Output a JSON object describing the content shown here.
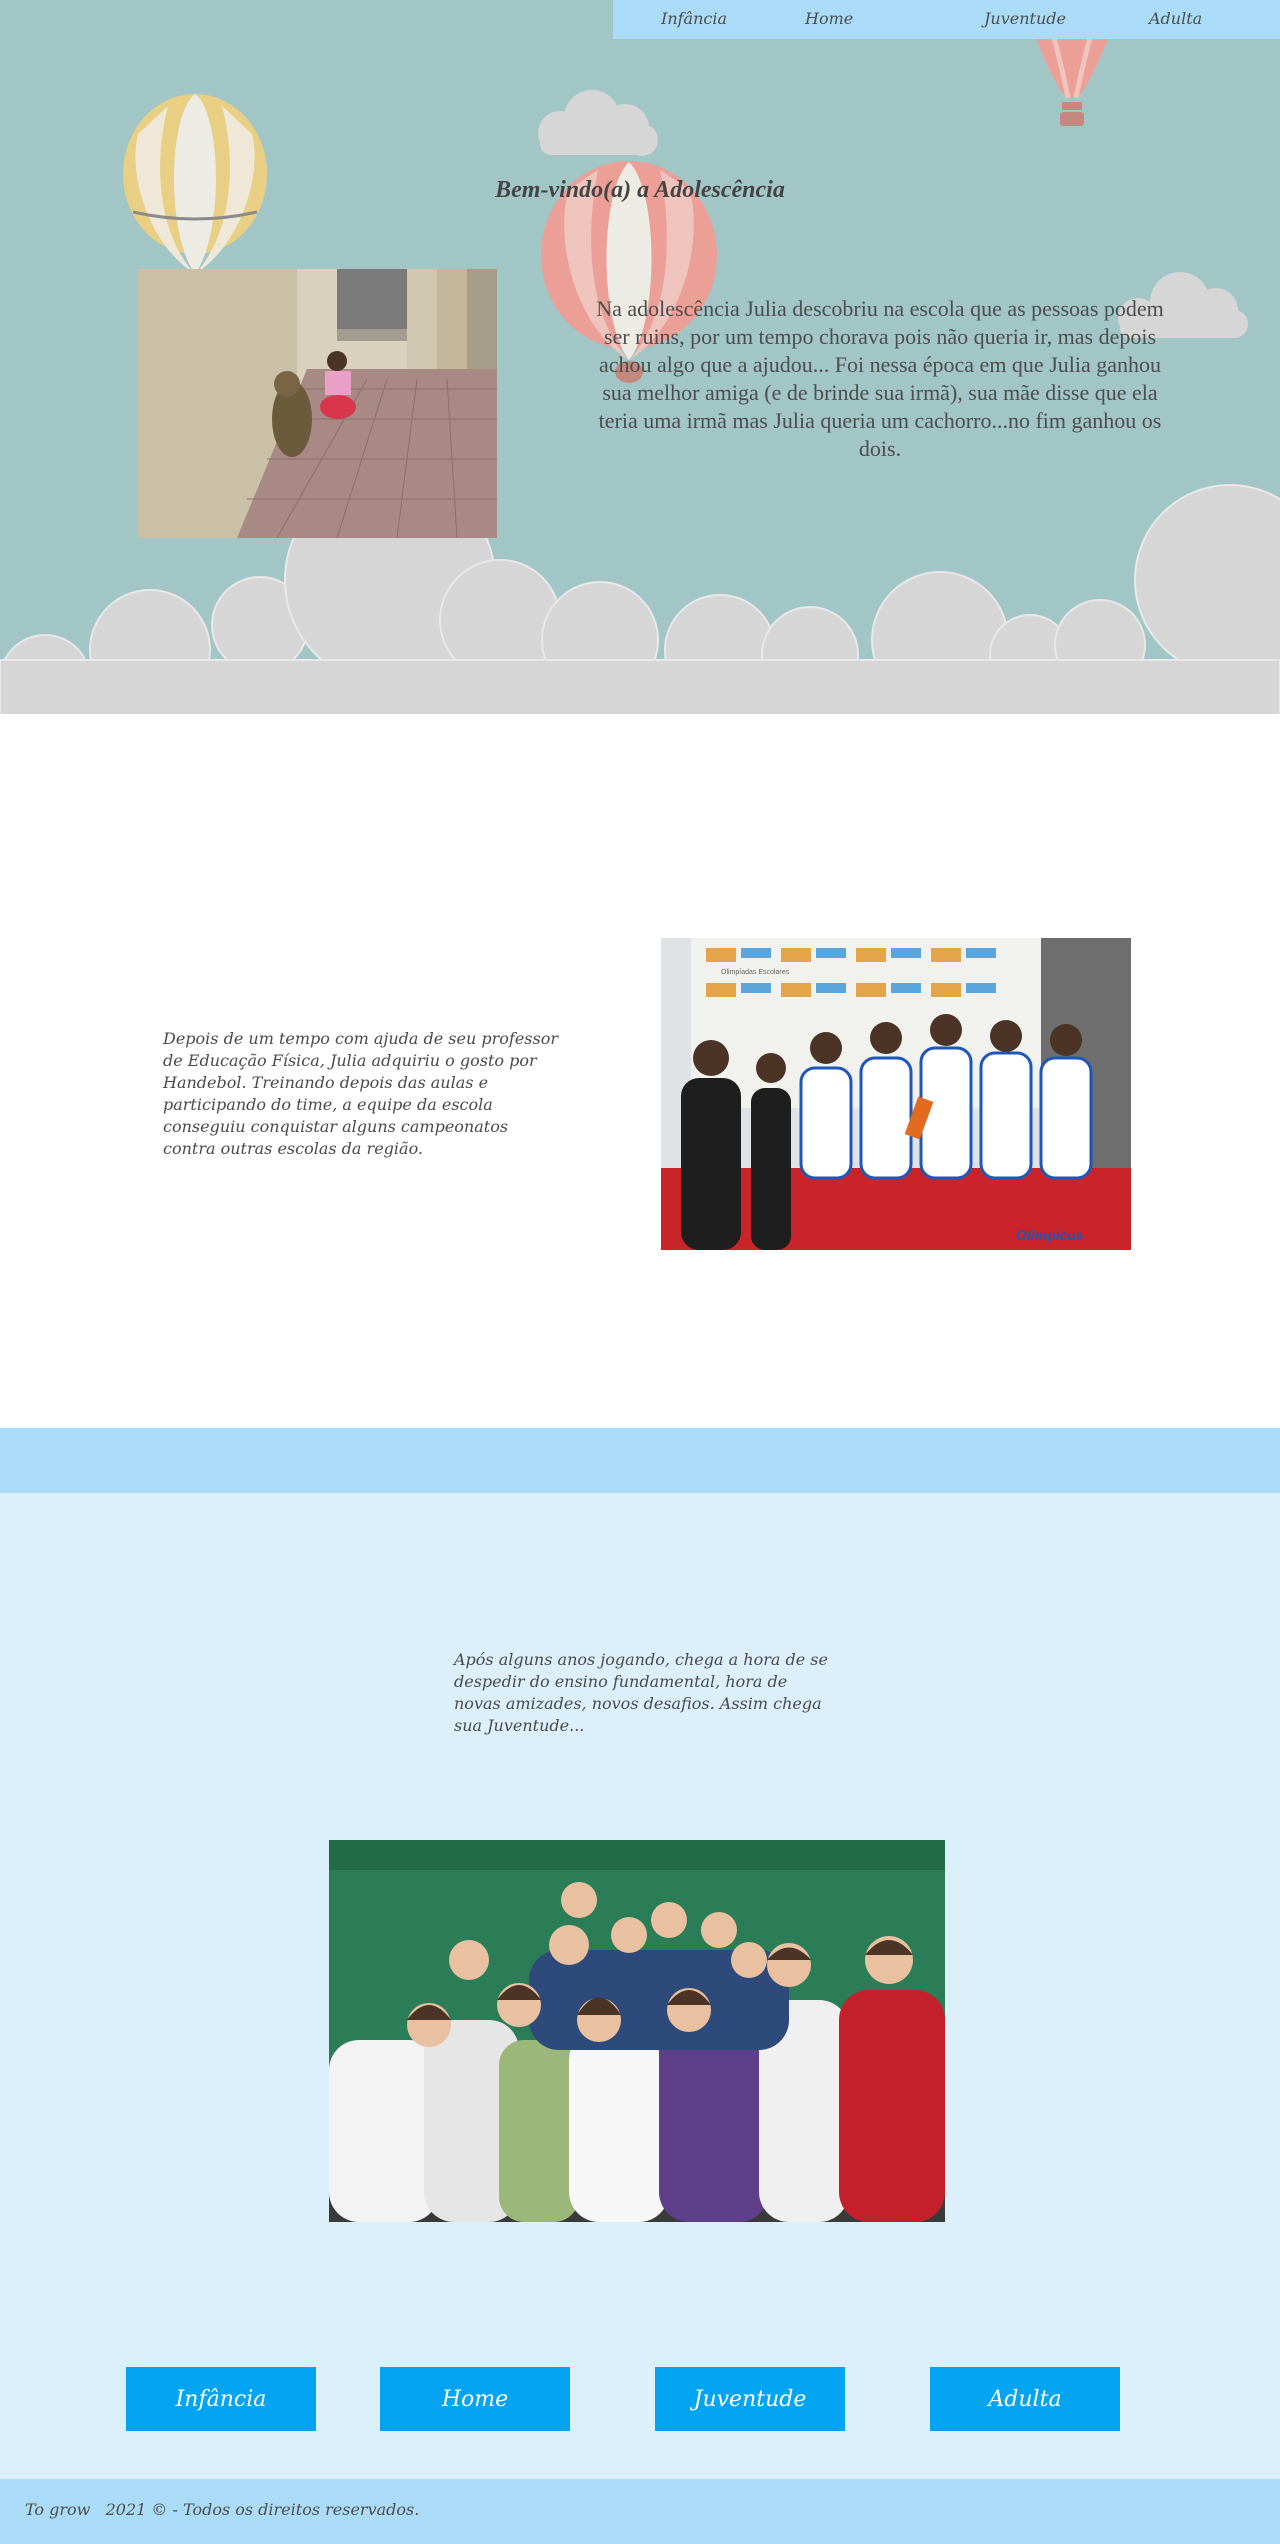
{
  "nav": {
    "infancia": "Infância",
    "home": "Home",
    "juventude": "Juventude",
    "adulta": "Adulta"
  },
  "hero": {
    "title": "Bem-vindo(a) a Adolescência",
    "paragraph": "Na adolescência Julia descobriu na escola que as pessoas podem ser ruins, por um tempo chorava pois não queria ir, mas depois achou algo que a ajudou... Foi nessa época em que Julia ganhou sua melhor amiga (e de brinde sua irmã), sua mãe disse que ela teria uma irmã mas Julia queria um cachorro...no fim ganhou os dois."
  },
  "section2": {
    "paragraph": "Depois de um tempo com ajuda de seu professor de Educação Física, Julia adquiriu o gosto por Handebol. Treinando depois das aulas e participando do time, a equipe da escola conseguiu conquistar alguns campeonatos contra outras escolas da região.",
    "photo_banner_text": "Olimpíadas Escolares",
    "photo_watermark": "Olimpicus"
  },
  "section3": {
    "paragraph": "Após alguns anos jogando, chega a hora de se despedir do ensino fundamental, hora de novas amizades, novos desafios. Assim chega sua Juventude..."
  },
  "buttons": {
    "infancia": "Infância",
    "home": "Home",
    "juventude": "Juventude",
    "adulta": "Adulta"
  },
  "footer": {
    "text": "To grow   2021 © - Todos os direitos reservados."
  },
  "colors": {
    "hero_bg": "#a2c5c6",
    "nav_bg": "#aadcf8",
    "section3_bg": "#dcf0fb",
    "button_bg": "#03a5f2",
    "cloud": "#d6d6d6"
  }
}
